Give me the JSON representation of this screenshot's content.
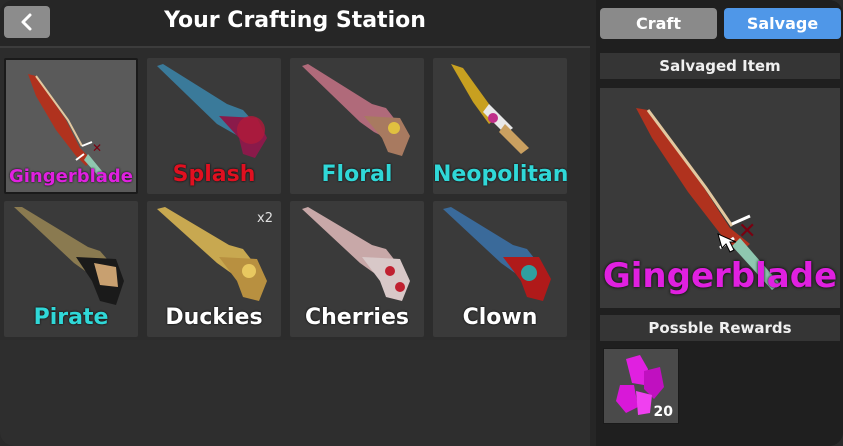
{
  "header": {
    "back_label": "<",
    "title": "Your Crafting Station"
  },
  "items": [
    {
      "name": "Gingerblade",
      "color": "#e020e0",
      "selected": true,
      "badge": ""
    },
    {
      "name": "Splash",
      "color": "#e01020",
      "selected": false,
      "badge": ""
    },
    {
      "name": "Floral",
      "color": "#30d8d8",
      "selected": false,
      "badge": ""
    },
    {
      "name": "Neopolitan",
      "color": "#30d8d8",
      "selected": false,
      "badge": ""
    },
    {
      "name": "Pirate",
      "color": "#30d8d8",
      "selected": false,
      "badge": ""
    },
    {
      "name": "Duckies",
      "color": "#ffffff",
      "selected": false,
      "badge": "x2"
    },
    {
      "name": "Cherries",
      "color": "#ffffff",
      "selected": false,
      "badge": ""
    },
    {
      "name": "Clown",
      "color": "#ffffff",
      "selected": false,
      "badge": ""
    }
  ],
  "tabs": {
    "craft": "Craft",
    "salvage": "Salvage",
    "active": "Salvage"
  },
  "salvage": {
    "header": "Salvaged Item",
    "item_name": "Gingerblade",
    "item_color": "#e020e0",
    "rewards_header": "Possble Rewards",
    "rewards": [
      {
        "icon": "pink-crystal-icon",
        "count": "20"
      }
    ]
  },
  "colors": {
    "accent": "#4f97e8",
    "legendary": "#e020e0"
  }
}
